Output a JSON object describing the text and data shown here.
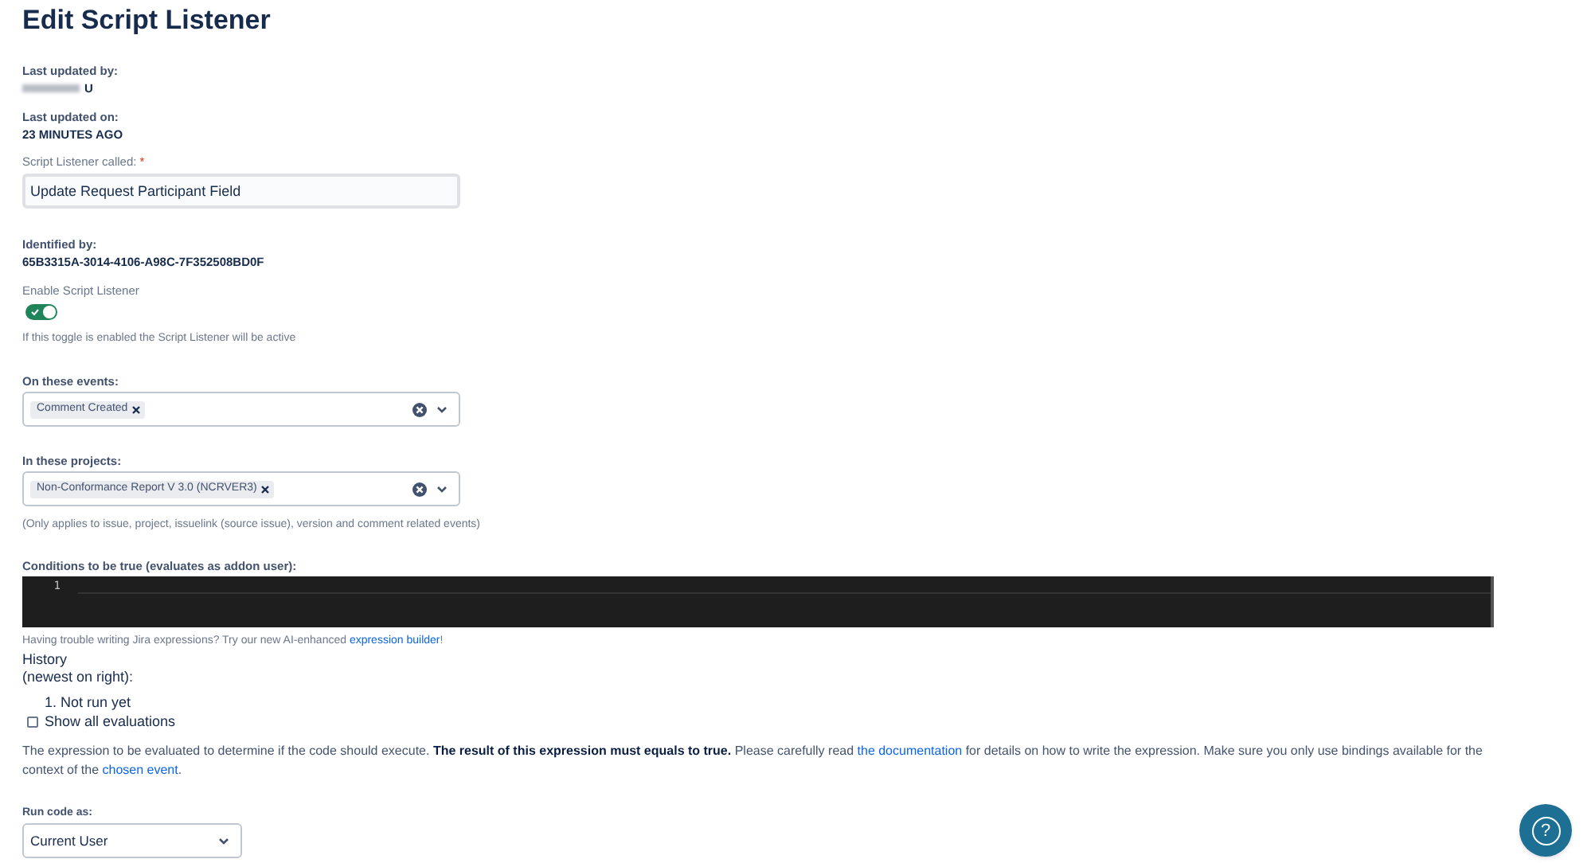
{
  "page_title": "Edit Script Listener",
  "last_updated_by": {
    "label": "Last updated by:",
    "value": "U",
    "redacted": true
  },
  "last_updated_on": {
    "label": "Last updated on:",
    "value": "23 MINUTES AGO"
  },
  "name_field": {
    "label": "Script Listener called:",
    "required_mark": "*",
    "value": "Update Request Participant Field"
  },
  "identified_by": {
    "label": "Identified by:",
    "value": "65B3315A-3014-4106-A98C-7F352508BD0F"
  },
  "enable_toggle": {
    "label": "Enable Script Listener",
    "on": true,
    "hint": "If this toggle is enabled the Script Listener will be active"
  },
  "events": {
    "label": "On these events:",
    "tags": [
      "Comment Created"
    ]
  },
  "projects": {
    "label": "In these projects:",
    "tags": [
      "Non-Conformance Report V 3.0 (NCRVER3)"
    ],
    "note": "(Only applies to issue, project, issuelink (source issue), version and comment related events)"
  },
  "conditions": {
    "label": "Conditions to be true (evaluates as addon user):",
    "line_numbers": [
      "1"
    ]
  },
  "helper": [
    {
      "kind": "text",
      "text": "Having trouble writing Jira expressions? Try our new AI-enhanced "
    },
    {
      "kind": "link",
      "text": "expression builder"
    },
    {
      "kind": "text",
      "text": "!"
    }
  ],
  "history": {
    "title": "History",
    "subtitle": "(newest on right):",
    "entries": [
      "1. Not run yet"
    ]
  },
  "show_all": {
    "label": "Show all evaluations",
    "checked": false
  },
  "description": [
    {
      "kind": "text",
      "text": "The expression to be evaluated to determine if the code should execute. "
    },
    {
      "kind": "bold",
      "text": "The result of this expression must equals to true."
    },
    {
      "kind": "text",
      "text": " Please carefully read "
    },
    {
      "kind": "link",
      "text": "the documentation"
    },
    {
      "kind": "text",
      "text": " for details on how to write the expression. Make sure you only use bindings available for the context of the "
    },
    {
      "kind": "link",
      "text": "chosen event"
    },
    {
      "kind": "text",
      "text": "."
    }
  ],
  "run_as": {
    "label": "Run code as:",
    "value": "Current User"
  },
  "help_button": {
    "glyph": "?"
  }
}
